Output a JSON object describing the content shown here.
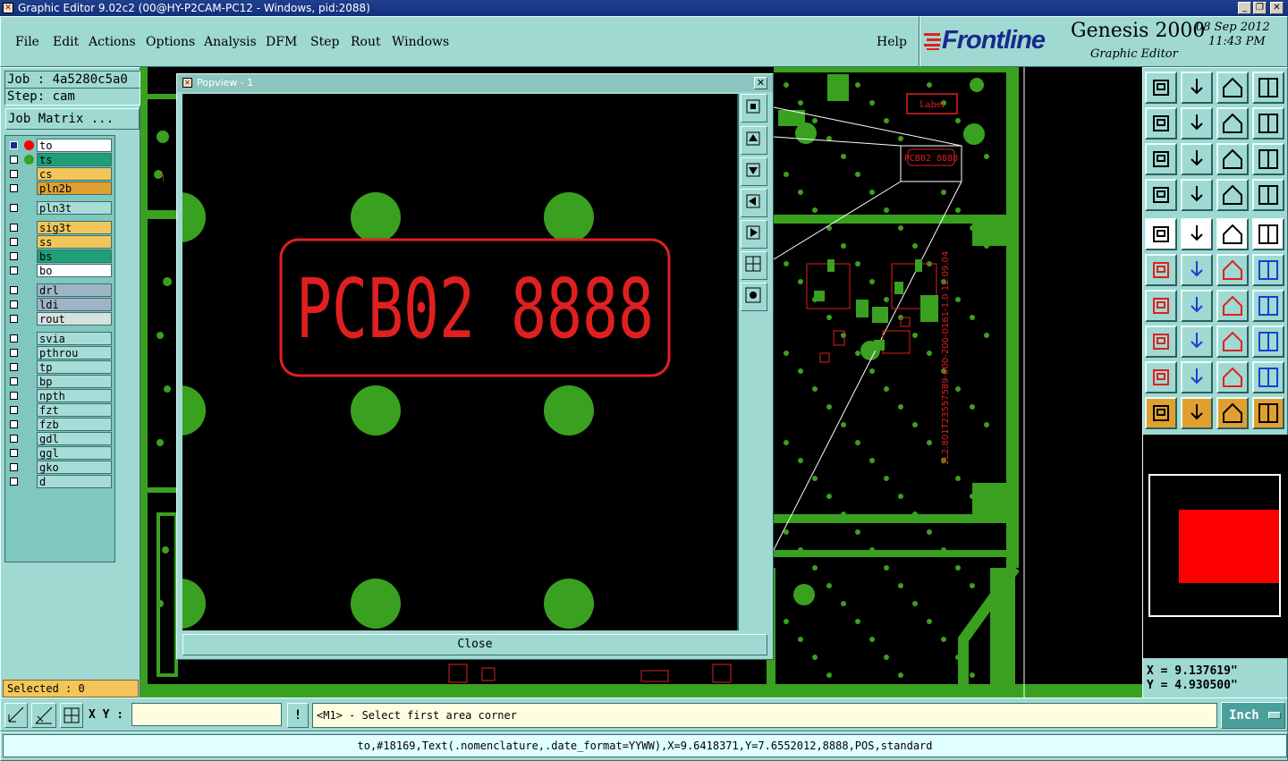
{
  "window": {
    "title": "Graphic Editor 9.02c2 (00@HY-P2CAM-PC12 - Windows, pid:2088)"
  },
  "menu": [
    "File",
    "Edit",
    "Actions",
    "Options",
    "Analysis",
    "DFM",
    "Step",
    "Rout",
    "Windows"
  ],
  "help_label": "Help",
  "brand": {
    "logo": "Frontline",
    "product": "Genesis 2000",
    "subtitle": "Graphic Editor",
    "date": "08 Sep 2012",
    "time": "11:43 PM"
  },
  "job": {
    "job_line": "Job : 4a5280c5a0",
    "step_line": "Step: cam",
    "matrix_button": "Job Matrix ..."
  },
  "layers": [
    {
      "name": "to",
      "color": "#ffffff"
    },
    {
      "name": "ts",
      "color": "#1f9f78"
    },
    {
      "name": "cs",
      "color": "#f2c65a"
    },
    {
      "name": "pln2b",
      "color": "#e0a030"
    },
    {
      "name": "pln3t",
      "color": "#a8dcd6"
    },
    {
      "name": "sig3t",
      "color": "#f2c65a"
    },
    {
      "name": "ss",
      "color": "#f2c65a"
    },
    {
      "name": "bs",
      "color": "#1f9f78"
    },
    {
      "name": "bo",
      "color": "#ffffff"
    },
    {
      "name": "drl",
      "color": "#9fb4c4"
    },
    {
      "name": "ldi",
      "color": "#9fb4c4"
    },
    {
      "name": "rout",
      "color": "#d8e0e0"
    },
    {
      "name": "svia",
      "color": "#a8dcd6"
    },
    {
      "name": "pthrou",
      "color": "#a8dcd6"
    },
    {
      "name": "tp",
      "color": "#a8dcd6"
    },
    {
      "name": "bp",
      "color": "#a8dcd6"
    },
    {
      "name": "npth",
      "color": "#a8dcd6"
    },
    {
      "name": "fzt",
      "color": "#a8dcd6"
    },
    {
      "name": "fzb",
      "color": "#a8dcd6"
    },
    {
      "name": "gdl",
      "color": "#a8dcd6"
    },
    {
      "name": "ggl",
      "color": "#a8dcd6"
    },
    {
      "name": "gko",
      "color": "#a8dcd6"
    },
    {
      "name": "d",
      "color": "#a8dcd6"
    }
  ],
  "selected_label": "Selected : 0",
  "popview": {
    "title": "Popview - 1",
    "close_label": "Close",
    "text": "PCB02 8888"
  },
  "board": {
    "label_box": "Label",
    "small_text": "PCB02 8888",
    "vertical_text": "2L2.801T23557589-000-200-0161-1.0 12.09.04"
  },
  "coords": {
    "x": "X = 9.137619\"",
    "y": "Y = 4.930500\""
  },
  "bottom": {
    "xy_label": "X Y :",
    "xy_value": "",
    "prompt": "<M1> - Select first area corner",
    "units": "Inch"
  },
  "status_line": "to,#18169,Text(.nomenclature,.date_format=YYWW),X=9.6418371,Y=7.6552012,8888,POS,standard"
}
